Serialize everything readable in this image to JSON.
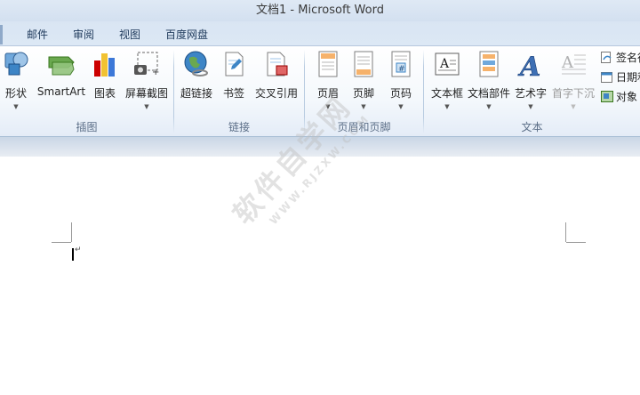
{
  "window": {
    "title": "文档1  -  Microsoft Word"
  },
  "tabs": [
    {
      "label": "邮件"
    },
    {
      "label": "审阅"
    },
    {
      "label": "视图"
    },
    {
      "label": "百度网盘"
    }
  ],
  "ribbon": {
    "illustrations": {
      "label": "插图",
      "shapes": "形状",
      "smartart": "SmartArt",
      "chart": "图表",
      "screenshot": "屏幕截图"
    },
    "links": {
      "label": "链接",
      "hyperlink": "超链接",
      "bookmark": "书签",
      "cross_reference": "交叉引用"
    },
    "header_footer": {
      "label": "页眉和页脚",
      "header": "页眉",
      "footer": "页脚",
      "page_number": "页码"
    },
    "text": {
      "label": "文本",
      "text_box": "文本框",
      "quick_parts": "文档部件",
      "wordart": "艺术字",
      "drop_cap": "首字下沉",
      "signature_line": "签名行",
      "date_time": "日期和",
      "object": "对象"
    }
  },
  "document": {
    "watermark_main": "软件自学网",
    "watermark_url": "WWW.RJZXW.COM"
  },
  "colors": {
    "accent": "#1e395b",
    "ribbon_border": "#a9bfd6"
  }
}
